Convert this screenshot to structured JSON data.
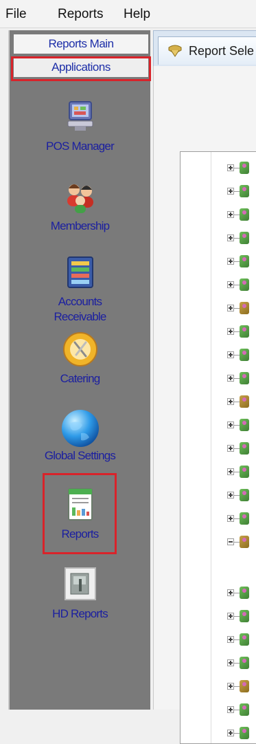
{
  "menu": {
    "file": "File",
    "reports": "Reports",
    "help": "Help"
  },
  "left_panel": {
    "reports_main": "Reports Main",
    "applications": "Applications",
    "apps": [
      {
        "label": "POS Manager"
      },
      {
        "label": "Membership"
      },
      {
        "label": "Accounts Receivable",
        "line1": "Accounts",
        "line2": "Receivable"
      },
      {
        "label": "Catering"
      },
      {
        "label": "Global Settings"
      },
      {
        "label": "Reports"
      },
      {
        "label": "HD Reports"
      }
    ]
  },
  "content": {
    "tab_label": "Report Sele"
  },
  "colors": {
    "highlight": "#d9232a",
    "link_text": "#1b1fa0",
    "panel_bg": "#7a7a7a"
  },
  "icons": [
    "pos-manager-icon",
    "membership-icon",
    "accounts-receivable-icon",
    "catering-icon",
    "globe-icon",
    "reports-icon",
    "hd-reports-icon",
    "report-selector-icon"
  ]
}
